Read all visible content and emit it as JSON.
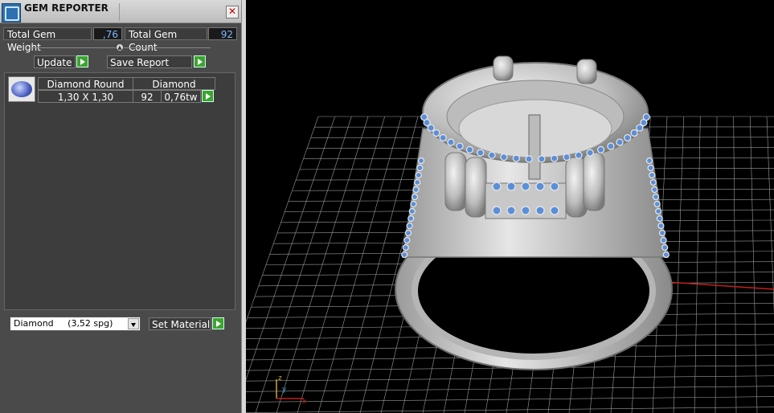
{
  "window": {
    "title": "GEM REPORTER",
    "close_glyph": "✕"
  },
  "totals": {
    "weight_label": "Total Gem Weight",
    "weight_value": ",76",
    "count_label": "Total Gem Count",
    "count_value": "92"
  },
  "actions": {
    "update_label": "Update",
    "save_report_label": "Save Report"
  },
  "gem_table": {
    "rows": [
      {
        "icon": "gem-round-icon",
        "shape": "Diamond Round",
        "material": "Diamond",
        "size": "1,30 X 1,30",
        "count": "92",
        "weight": "0,76tw"
      }
    ]
  },
  "material": {
    "selected": "Diamond     (3,52 spg)",
    "set_label": "Set Material"
  },
  "viewport": {
    "axis_labels": {
      "z": "z",
      "y": "y",
      "x": "x"
    },
    "colors": {
      "grid": "#9a9a9a",
      "x_axis": "#c0201b",
      "y_axis": "#1fb0c8",
      "metal": "#cfcfcf",
      "gem": "#5b8fd8"
    }
  }
}
